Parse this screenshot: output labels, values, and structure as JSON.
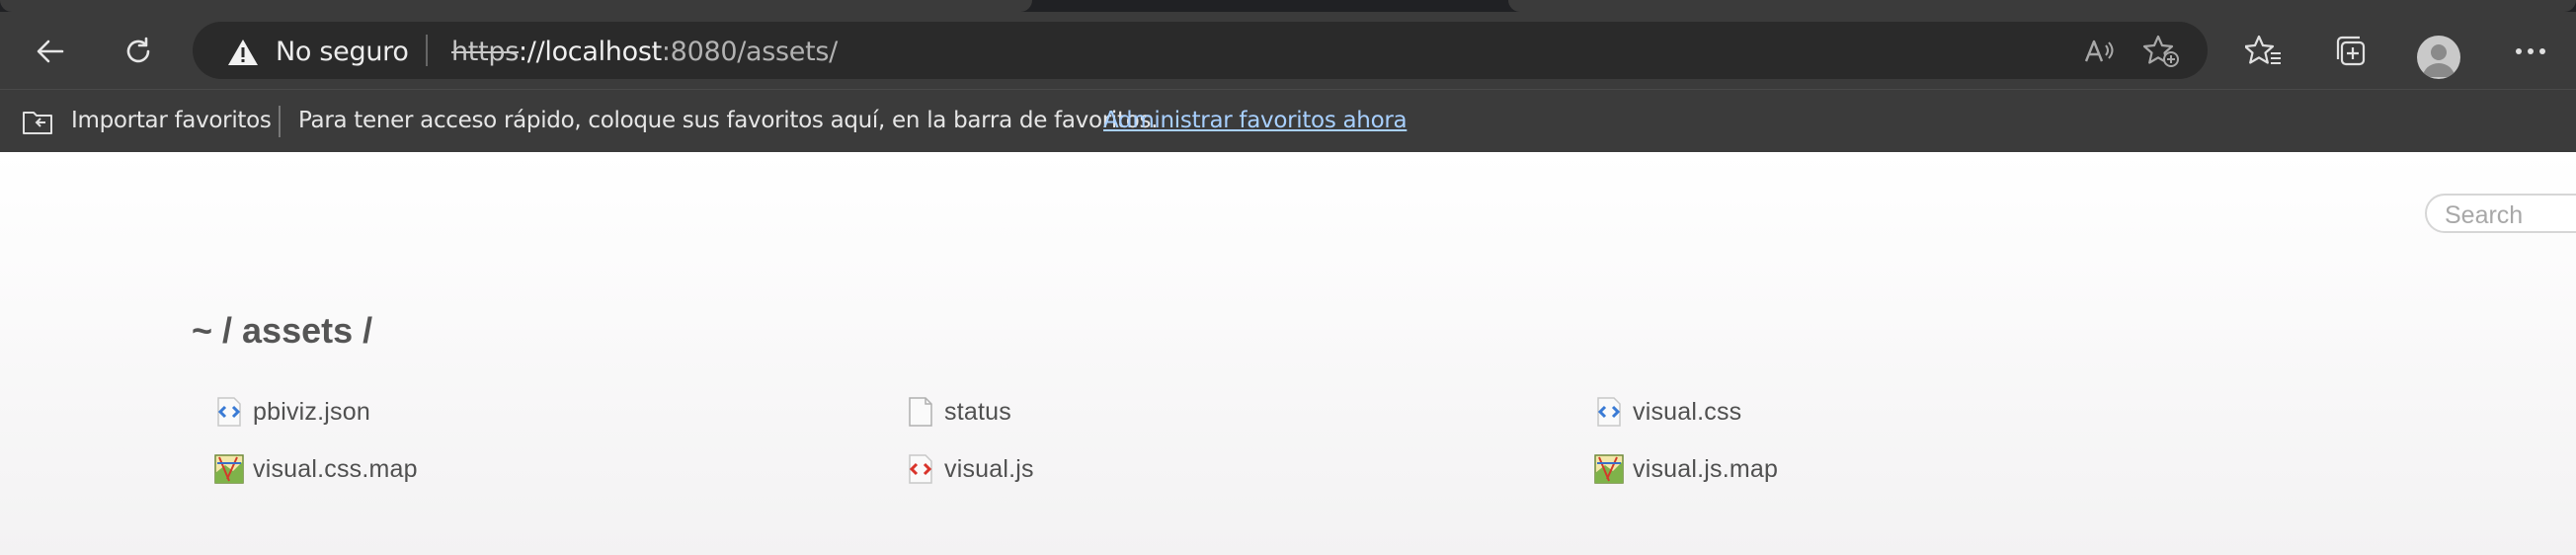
{
  "browser": {
    "security_label": "No seguro",
    "url_scheme": "https",
    "url_host": "://localhost",
    "url_rest": ":8080/assets/",
    "icons": [
      "back-icon",
      "refresh-icon",
      "warning-icon",
      "read-aloud-icon",
      "add-favorite-icon",
      "favorites-icon",
      "collections-icon",
      "profile-avatar",
      "more-icon"
    ]
  },
  "favorites_bar": {
    "import_label": "Importar favoritos",
    "hint": "Para tener acceso rápido, coloque sus favoritos aquí, en la barra de favoritos.",
    "manage_link": "Administrar favoritos ahora"
  },
  "page": {
    "search_placeholder": "Search",
    "breadcrumb": "~ / assets /",
    "files": [
      {
        "name": "pbiviz.json",
        "icon": "code-file-icon",
        "color": "#3a7bd5"
      },
      {
        "name": "status",
        "icon": "blank-file-icon",
        "color": "#b0b0b0"
      },
      {
        "name": "visual.css",
        "icon": "code-file-icon",
        "color": "#3a7bd5"
      },
      {
        "name": "visual.css.map",
        "icon": "map-file-icon",
        "color": "#3f8f3f"
      },
      {
        "name": "visual.js",
        "icon": "script-file-icon",
        "color": "#d9342b"
      },
      {
        "name": "visual.js.map",
        "icon": "map-file-icon",
        "color": "#3f8f3f"
      }
    ]
  }
}
